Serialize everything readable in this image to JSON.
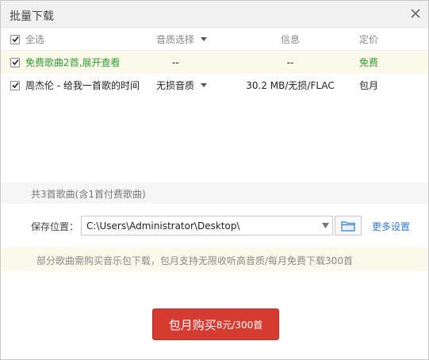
{
  "window": {
    "title": "批量下载"
  },
  "table": {
    "header": {
      "select_all": "全选",
      "quality": "音质选择",
      "info": "信息",
      "price": "定价"
    },
    "rows": [
      {
        "name": "免费歌曲2首,展开查看",
        "quality": "--",
        "info": "--",
        "price": "免费",
        "checked": true,
        "highlight_color": "#2e9d2e"
      },
      {
        "name": "周杰伦 - 给我一首歌的时间",
        "quality": "无损音质",
        "info": "30.2 MB/无损/FLAC",
        "price": "包月",
        "checked": true
      }
    ]
  },
  "summary": "共3首歌曲(含1首付费歌曲)",
  "save": {
    "label": "保存位置：",
    "path": "C:\\Users\\Administrator\\Desktop\\",
    "more_settings": "更多设置"
  },
  "notice": "部分歌曲需购买音乐包下载，包月支持无限收听高音质/每月免费下载300首",
  "buy_button": {
    "main": "包月购买",
    "price": "8元/300首",
    "color": "#d63b32"
  },
  "icons": {
    "close": "close-icon",
    "checkbox": "checkmark-icon",
    "dropdown": "chevron-down-icon",
    "folder": "folder-icon"
  }
}
